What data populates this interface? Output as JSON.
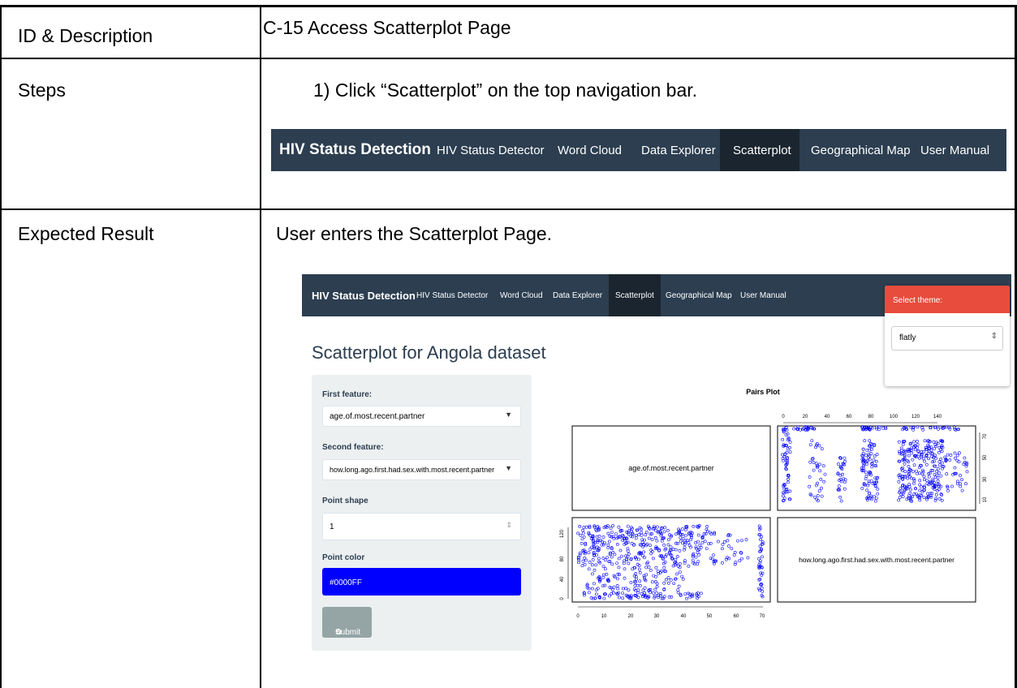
{
  "table": {
    "rows": [
      {
        "label": "ID & Description",
        "content": "C-15 Access Scatterplot Page"
      },
      {
        "label": "Steps",
        "content": "1)  Click  “Scatterplot” on the top navigation bar."
      },
      {
        "label": "Expected Result",
        "content": "User enters the Scatterplot Page."
      }
    ]
  },
  "nav": {
    "brand": "HIV Status Detection",
    "items": [
      "HIV Status Detector",
      "Word Cloud",
      "Data Explorer",
      "Scatterplot",
      "Geographical Map",
      "User Manual"
    ],
    "active": "Scatterplot",
    "bg_color": "#2c3e50",
    "active_color": "#1a252f"
  },
  "app": {
    "theme_selector": {
      "header": "Select theme:",
      "value": "flatly",
      "header_color": "#e74c3c"
    },
    "page_title": "Scatterplot for Angola dataset",
    "form": {
      "first_feature_label": "First feature:",
      "first_feature_value": "age.of.most.recent.partner",
      "second_feature_label": "Second feature:",
      "second_feature_value": "how.long.ago.first.had.sex.with.most.recent.partner",
      "point_shape_label": "Point shape",
      "point_shape_value": "1",
      "point_color_label": "Point color",
      "point_color_value": "#0000FF",
      "submit_label": "Submit",
      "submit_icon": "gear-icon"
    },
    "plot": {
      "title": "Pairs Plot",
      "var1": "age.of.most.recent.partner",
      "var2": "how.long.ago.first.had.sex.with.most.recent.partner",
      "top_axis_ticks": [
        "0",
        "20",
        "40",
        "60",
        "80",
        "100",
        "120",
        "140"
      ],
      "bottom_axis_ticks": [
        "0",
        "10",
        "20",
        "30",
        "40",
        "50",
        "60",
        "70"
      ],
      "left_axis_ticks": [
        "0",
        "40",
        "80",
        "120"
      ],
      "right_axis_ticks": [
        "10",
        "30",
        "50",
        "70"
      ],
      "point_color": "#0000ff"
    }
  }
}
